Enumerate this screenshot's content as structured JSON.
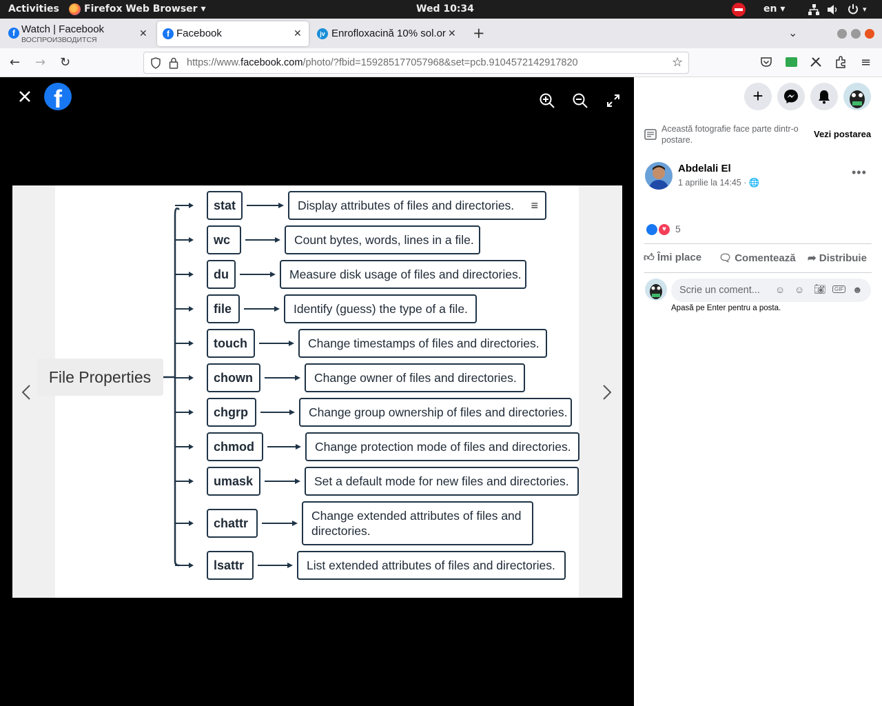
{
  "topbar": {
    "activities": "Activities",
    "app_menu": "Firefox Web Browser",
    "clock": "Wed 10:34",
    "lang": "en"
  },
  "tabs": [
    {
      "title": "Watch | Facebook",
      "subtitle": "ВОСПРОИЗВОДИТСЯ",
      "favicon": "f"
    },
    {
      "title": "Facebook",
      "favicon": "f"
    },
    {
      "title": "Enrofloxacină 10% sol.or",
      "favicon": "jv"
    }
  ],
  "navbar": {
    "url_prefix": "https://www.",
    "url_host": "facebook.com",
    "url_path": "/photo/?fbid=159285177057968&set=pcb.9104572142917820"
  },
  "diagram": {
    "root": "File Properties",
    "rows": [
      {
        "cmd": "stat",
        "desc": "Display attributes of files and directories."
      },
      {
        "cmd": "wc",
        "desc": "Count bytes, words, lines in a file."
      },
      {
        "cmd": "du",
        "desc": "Measure disk usage of files and directories."
      },
      {
        "cmd": "file",
        "desc": "Identify (guess) the type of a file."
      },
      {
        "cmd": "touch",
        "desc": "Change timestamps of files and directories."
      },
      {
        "cmd": "chown",
        "desc": "Change owner of files and directories."
      },
      {
        "cmd": "chgrp",
        "desc": "Change group ownership of files and directories."
      },
      {
        "cmd": "chmod",
        "desc": "Change protection mode of files and directories."
      },
      {
        "cmd": "umask",
        "desc": "Set a default mode for new files and directories."
      },
      {
        "cmd": "chattr",
        "desc": "Change extended attributes of files and directories."
      },
      {
        "cmd": "lsattr",
        "desc": "List extended attributes of files and directories."
      }
    ]
  },
  "panel": {
    "notice": "Această fotografie face parte dintr-o postare.",
    "see_post": "Vezi postarea",
    "author": "Abdelali El",
    "date": "1 aprilie la 14:45 ·",
    "reaction_count": "5",
    "like": "Îmi place",
    "comment": "Comentează",
    "share": "Distribuie",
    "comment_placeholder": "Scrie un coment...",
    "enter_hint": "Apasă pe Enter pentru a posta."
  }
}
